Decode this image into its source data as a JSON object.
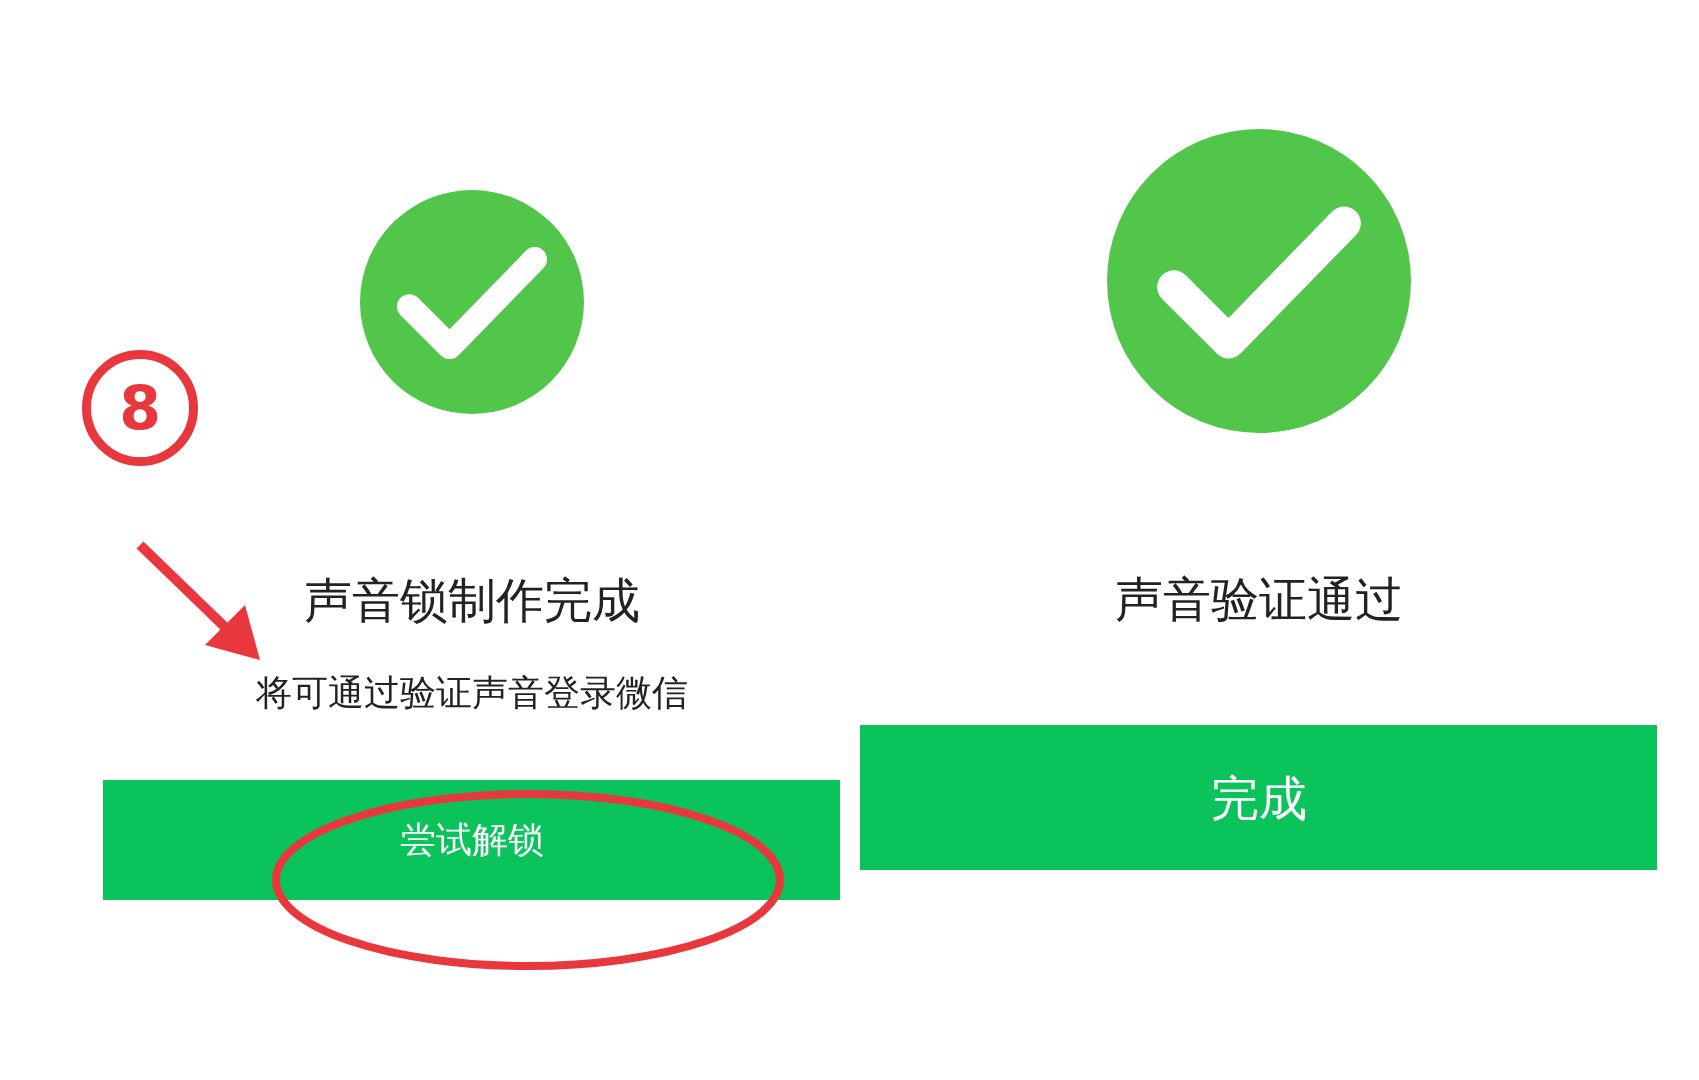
{
  "screens": [
    {
      "title": "声音锁制作完成",
      "subtitle": "将可通过验证声音登录微信",
      "button": "尝试解锁"
    },
    {
      "title": "声音验证通过",
      "button": "完成"
    }
  ],
  "annotation": {
    "step": "8"
  }
}
